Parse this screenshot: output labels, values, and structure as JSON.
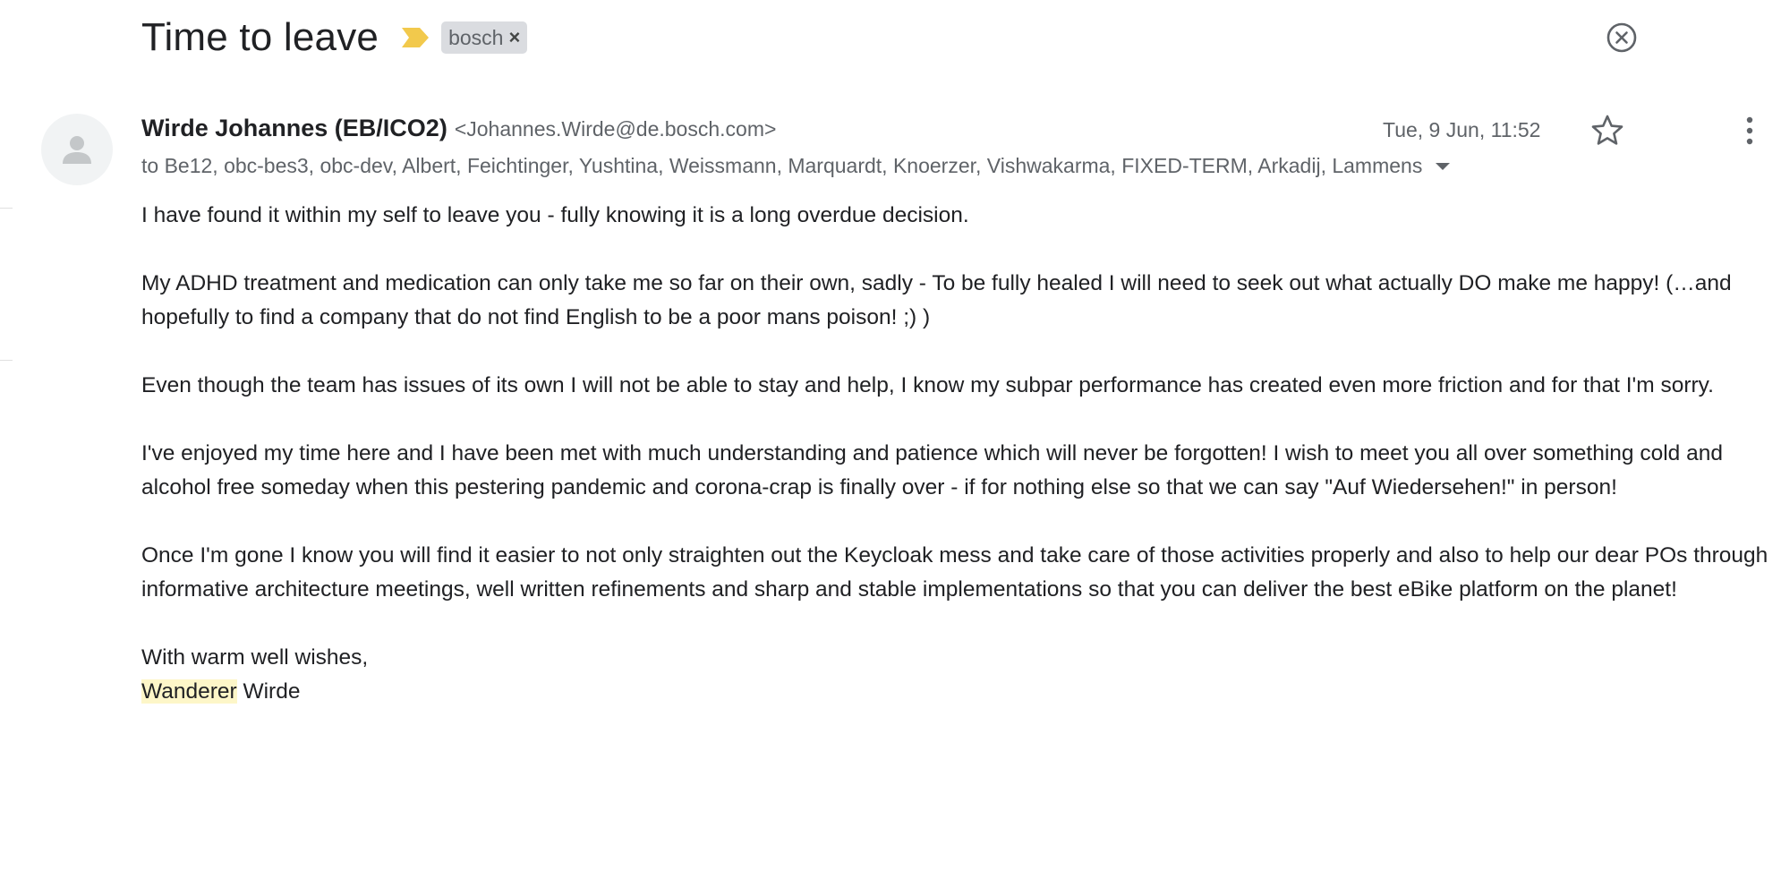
{
  "thread": {
    "subject": "Time to leave",
    "label": "bosch",
    "label_remove": "×"
  },
  "message": {
    "sender_name": "Wirde Johannes (EB/ICO2)",
    "sender_email": "<Johannes.Wirde@de.bosch.com>",
    "date": "Tue, 9 Jun, 11:52",
    "recipients": "to Be12, obc-bes3, obc-dev, Albert, Feichtinger, Yushtina, Weissmann, Marquardt, Knoerzer, Vishwakarma, FIXED-TERM, Arkadij, Lammens",
    "body": [
      "I have found it within my self to leave you - fully knowing it is a long overdue decision.",
      "My ADHD treatment and medication can only take me so far on their own, sadly - To be fully healed I will need to seek out what actually DO make me happy! (…and hopefully to find a company that do not find English to be a poor mans poison! ;) )",
      "Even though the team has issues of its own I will not be able to stay and help, I know my subpar performance has created even more friction and for that I'm sorry.",
      "I've enjoyed my time here and I have been met with much understanding and patience which will never be forgotten! I wish to meet you all over something cold and alcohol free someday when this pestering pandemic and corona-crap is finally over - if for nothing else so that we can say \"Auf Wiedersehen!\" in person!",
      "Once I'm gone I know you will find it easier to not only straighten out the Keycloak mess and take care of those activities properly and also to help our dear POs through informative architecture meetings, well written refinements and sharp and stable implementations so that you can deliver the best eBike platform on the planet!"
    ],
    "closing": "With warm well wishes,",
    "signature_first": "Wanderer",
    "signature_last": " Wirde"
  },
  "icons": {
    "importance": "importance-marker-icon",
    "close": "close-circle-icon",
    "avatar": "person-icon",
    "star": "star-outline-icon",
    "more": "more-vertical-icon",
    "expand": "caret-down-icon"
  },
  "colors": {
    "importance": "#f2c94c",
    "chip_bg": "#dadce0",
    "secondary_text": "#5f6368",
    "highlight": "#fdf6c8"
  }
}
